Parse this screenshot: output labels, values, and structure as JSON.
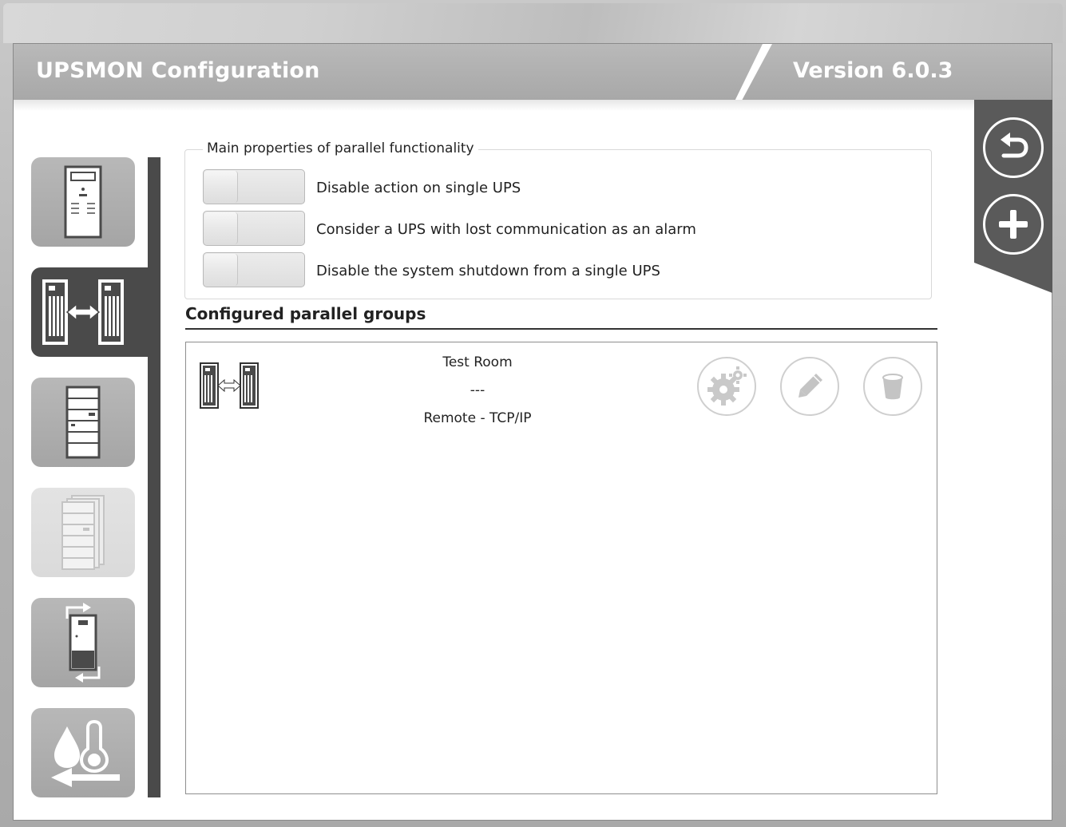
{
  "window": {
    "title": "UPSMON Configuration",
    "version": "Version 6.0.3"
  },
  "nav": {
    "items": [
      {
        "name": "single-ups",
        "icon": "ups-tower-icon",
        "state": "normal"
      },
      {
        "name": "parallel-ups",
        "icon": "parallel-ups-icon",
        "state": "active"
      },
      {
        "name": "rack-ups",
        "icon": "rack-ups-icon",
        "state": "normal"
      },
      {
        "name": "multi-rack-ups",
        "icon": "multi-rack-icon",
        "state": "disabled"
      },
      {
        "name": "ups-transfer",
        "icon": "ups-transfer-icon",
        "state": "normal"
      },
      {
        "name": "environment-sensor",
        "icon": "environment-sensor-icon",
        "state": "normal"
      }
    ]
  },
  "actions": {
    "back": "back-icon",
    "add": "add-icon"
  },
  "properties": {
    "title": "Main properties of parallel functionality",
    "options": [
      {
        "label": "Disable action on single UPS",
        "enabled": false
      },
      {
        "label": "Consider a UPS with lost communication as an alarm",
        "enabled": false
      },
      {
        "label": "Disable the system shutdown from a single UPS",
        "enabled": false
      }
    ]
  },
  "groups": {
    "title": "Configured parallel groups",
    "items": [
      {
        "name": "Test Room",
        "detail": "---",
        "connection": "Remote - TCP/IP",
        "icon": "parallel-ups-icon",
        "buttons": [
          "settings-icon",
          "edit-icon",
          "delete-icon"
        ]
      }
    ]
  }
}
